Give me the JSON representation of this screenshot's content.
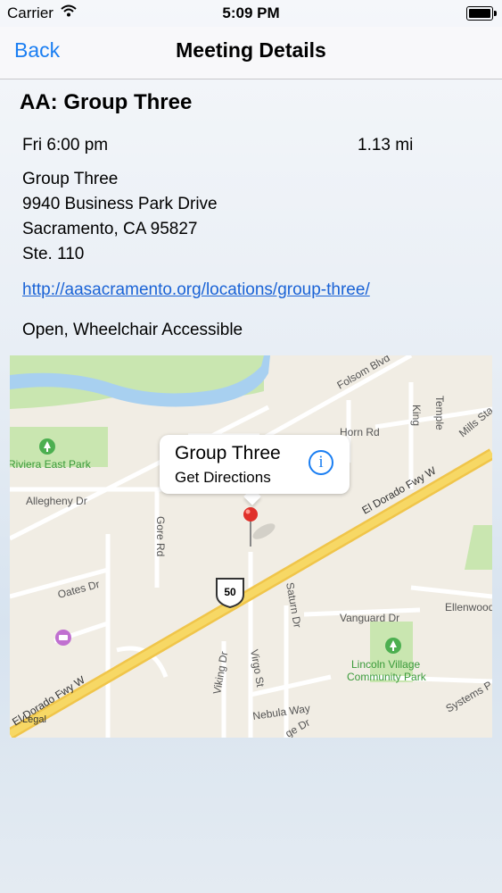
{
  "status_bar": {
    "carrier": "Carrier",
    "time": "5:09 PM"
  },
  "nav": {
    "back_label": "Back",
    "title": "Meeting Details"
  },
  "meeting": {
    "title": "AA: Group Three",
    "day_time": "Fri 6:00 pm",
    "distance": "1.13 mi",
    "address_lines": [
      "Group Three",
      "9940 Business Park Drive",
      "Sacramento, CA 95827",
      "Ste. 110"
    ],
    "url": "http://aasacramento.org/locations/group-three/",
    "features": "Open, Wheelchair Accessible"
  },
  "map": {
    "callout_title": "Group Three",
    "callout_subtitle": "Get Directions",
    "legal": "Legal",
    "highway_shield": "50",
    "labels": {
      "folsom": "Folsom Blvd",
      "horn": "Horn Rd",
      "king": "King",
      "temple": "Temple",
      "mills": "Mills Sta",
      "riviera": "Riviera East Park",
      "allegheny": "Allegheny Dr",
      "gore": "Gore Rd",
      "eldorado_upper": "El Dorado Fwy W",
      "oates": "Oates Dr",
      "saturn": "Saturn Dr",
      "vanguard": "Vanguard Dr",
      "ellenwood": "Ellenwood Av",
      "lincoln1": "Lincoln Village",
      "lincoln2": "Community Park",
      "eldorado_lower": "El Dorado Fwy W",
      "viking": "Viking Dr",
      "virgo": "Virgo St",
      "nebula": "Nebula Way",
      "ge_dr": "ge Dr",
      "systems": "Systems P"
    }
  }
}
